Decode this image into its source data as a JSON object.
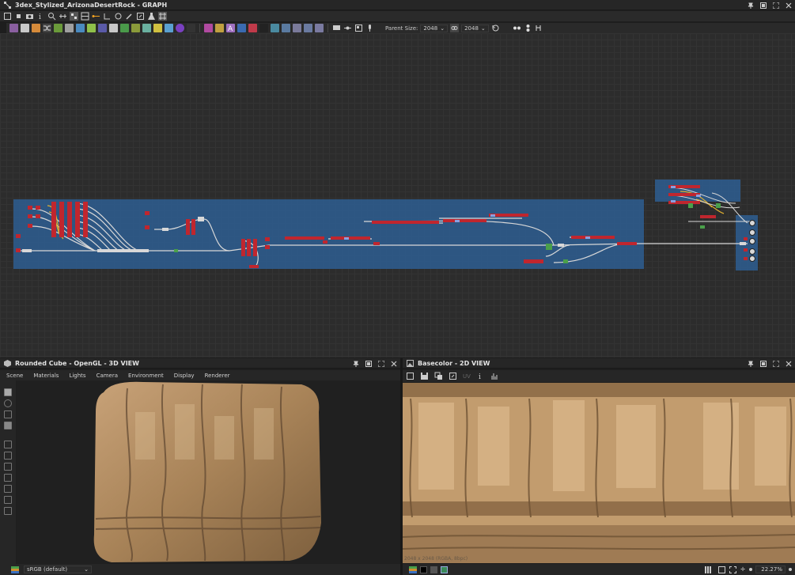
{
  "graph_window": {
    "title": "3dex_Stylized_ArizonaDesertRock - GRAPH"
  },
  "graph_toolbar": {
    "parent_size_label": "Parent Size:",
    "parent_size_value": "2048",
    "second_size_value": "2048"
  },
  "view3d": {
    "title": "Rounded Cube - OpenGL - 3D VIEW",
    "menu": [
      "Scene",
      "Materials",
      "Lights",
      "Camera",
      "Environment",
      "Display",
      "Renderer"
    ],
    "colorspace": "sRGB (default)"
  },
  "view2d": {
    "title": "Basecolor - 2D VIEW",
    "toolbar_label": "UV",
    "info": "2048 x 2048 (RGBA, 8bpc)",
    "zoom": "22.27%"
  },
  "colors": {
    "accent_blue": "#2e5a8a",
    "node_red": "#c0262e",
    "rock": "#b48d5f"
  }
}
